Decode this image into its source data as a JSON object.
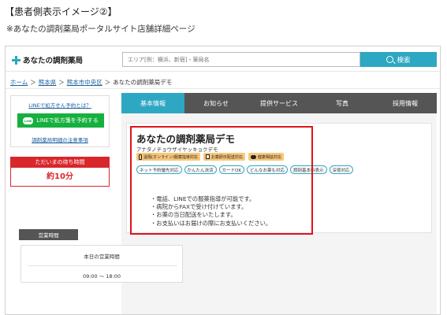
{
  "doc": {
    "title": "【患者側表示イメージ②】",
    "subtitle": "※あなたの調剤薬局ポータルサイト店舗詳細ページ"
  },
  "header": {
    "logo_text": "あなたの調剤薬局",
    "search_placeholder": "エリア[例：横浜、新宿]・薬局名",
    "search_button": "検索"
  },
  "breadcrumb": {
    "items": [
      "ホーム",
      "熊本県",
      "熊本市中央区",
      "あなたの調剤薬局デモ"
    ],
    "separator": "＞"
  },
  "sidebar": {
    "link_top": "LINEで処方せん予約とは？",
    "line_button": "LINEで処方箋を予約する",
    "line_icon_text": "LINE",
    "link_bottom": "調剤薬局明細の注意事項",
    "wait_label": "ただいまの待ち時間",
    "wait_value": "約10分"
  },
  "tabs": [
    "基本情報",
    "お知らせ",
    "提供サービス",
    "写真",
    "採用情報"
  ],
  "store": {
    "name": "あなたの調剤薬局デモ",
    "kana": "アナタノチョウザイヤッキョクデモ",
    "badges": [
      "遠隔(オンライン)服薬指導対応",
      "お薬即日配送対応",
      "健康相談対応"
    ],
    "tags": [
      "ネット予約優先対応",
      "かんたん決済",
      "カードOK",
      "どんなお薬も対応",
      "調剤基本料表示",
      "深夜対応"
    ],
    "notes": [
      "・電話、LINEでの服薬指導が可能です。",
      "・病院からFAXで受け付けています。",
      "・お薬の当日配送をいたします。",
      "・お支払いはお届けの際にお支払いください。"
    ]
  },
  "hours": {
    "label": "営業時間",
    "title": "本日の営業時間",
    "time": "09:00 ～ 18:00"
  },
  "colors": {
    "accent": "#2ea7c2",
    "line_green": "#15b03e",
    "alert_red": "#d9262b",
    "highlight_red": "#e0141b",
    "badge_orange": "#f7c77a",
    "tab_dark": "#555555"
  }
}
